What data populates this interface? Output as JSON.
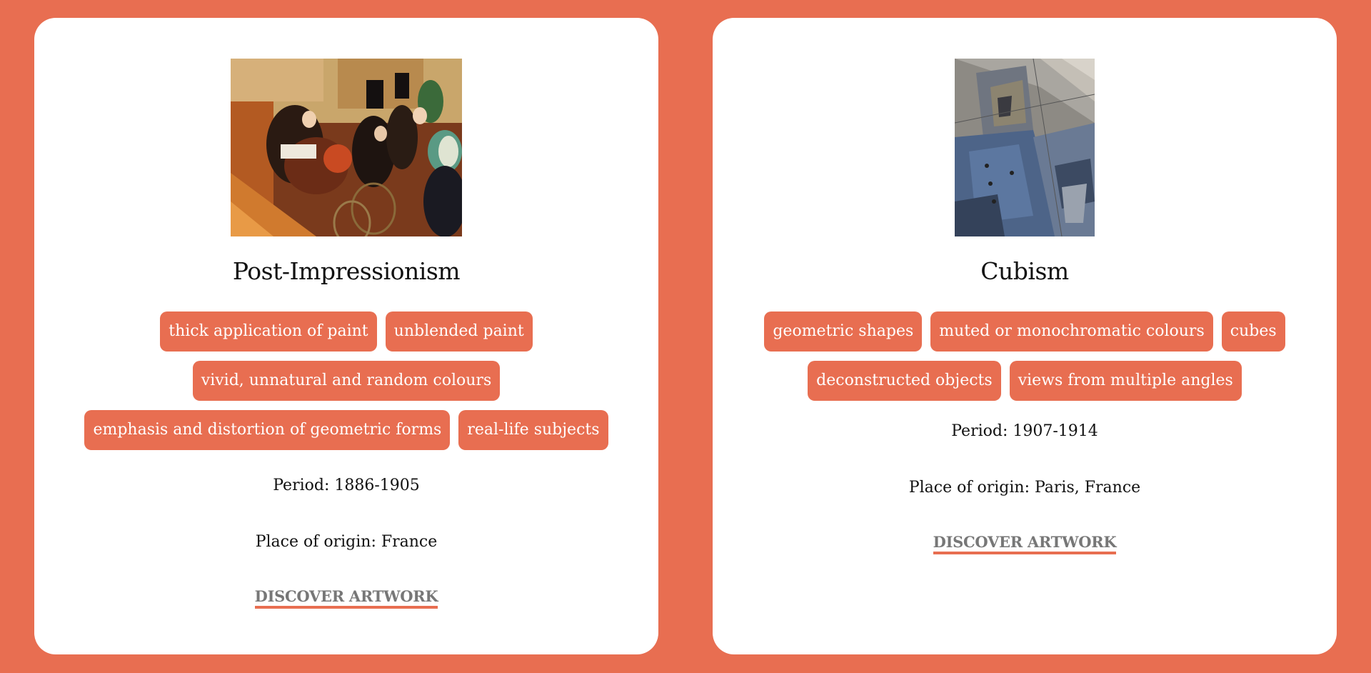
{
  "cards": [
    {
      "title": "Post-Impressionism",
      "artwork_icon": "painting-moulin-rouge-icon",
      "tags": [
        "thick application of paint",
        "unblended paint",
        "vivid, unnatural and random colours",
        "emphasis and distortion of geometric forms",
        "real-life subjects"
      ],
      "period": "Period: 1886-1905",
      "origin": "Place of origin: France",
      "cta": "DISCOVER ARTWORK"
    },
    {
      "title": "Cubism",
      "artwork_icon": "painting-cubist-portrait-icon",
      "tags": [
        "geometric shapes",
        "muted or monochromatic colours",
        "cubes",
        "deconstructed objects",
        "views from multiple angles"
      ],
      "period": "Period: 1907-1914",
      "origin": "Place of origin: Paris, France",
      "cta": "DISCOVER ARTWORK"
    }
  ],
  "colors": {
    "background": "#E86E51",
    "card": "#FFFFFF",
    "tag": "#E86E51",
    "cta_text": "#777777"
  }
}
